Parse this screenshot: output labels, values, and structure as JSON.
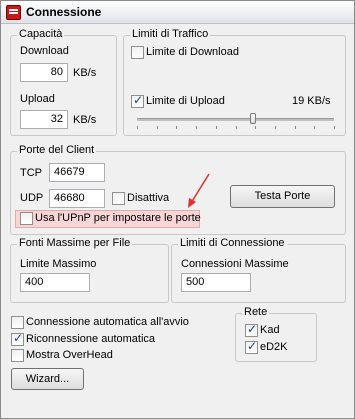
{
  "title": "Connessione",
  "capacita": {
    "label": "Capacità",
    "download_label": "Download",
    "download_value": "80",
    "download_unit": "KB/s",
    "upload_label": "Upload",
    "upload_value": "32",
    "upload_unit": "KB/s"
  },
  "limiti_traffico": {
    "label": "Limiti di Traffico",
    "limite_download_label": "Limite di Download",
    "limite_download_checked": false,
    "limite_upload_label": "Limite di Upload",
    "limite_upload_checked": true,
    "upload_limit_value": "19 KB/s",
    "upload_slider_fraction": 0.59
  },
  "porte": {
    "label": "Porte del Client",
    "tcp_label": "TCP",
    "tcp_value": "46679",
    "udp_label": "UDP",
    "udp_value": "46680",
    "disattiva_label": "Disattiva",
    "upnp_label": "Usa l'UPnP per impostare le porte",
    "testa_porte_label": "Testa Porte"
  },
  "fonti": {
    "label": "Fonti Massime per File",
    "limite_label": "Limite Massimo",
    "limite_value": "400"
  },
  "limiti_connessione": {
    "label": "Limiti di Connessione",
    "connessioni_label": "Connessioni Massime",
    "connessioni_value": "500"
  },
  "options": {
    "auto_connect_label": "Connessione automatica all'avvio",
    "auto_connect_checked": false,
    "reconnect_label": "Riconnessione automatica",
    "reconnect_checked": true,
    "overhead_label": "Mostra OverHead",
    "overhead_checked": false
  },
  "rete": {
    "label": "Rete",
    "kad_label": "Kad",
    "kad_checked": true,
    "ed2k_label": "eD2K",
    "ed2k_checked": true
  },
  "wizard_label": "Wizard...",
  "colors": {
    "highlight": "#f6d6d6",
    "arrow": "#e03030"
  }
}
